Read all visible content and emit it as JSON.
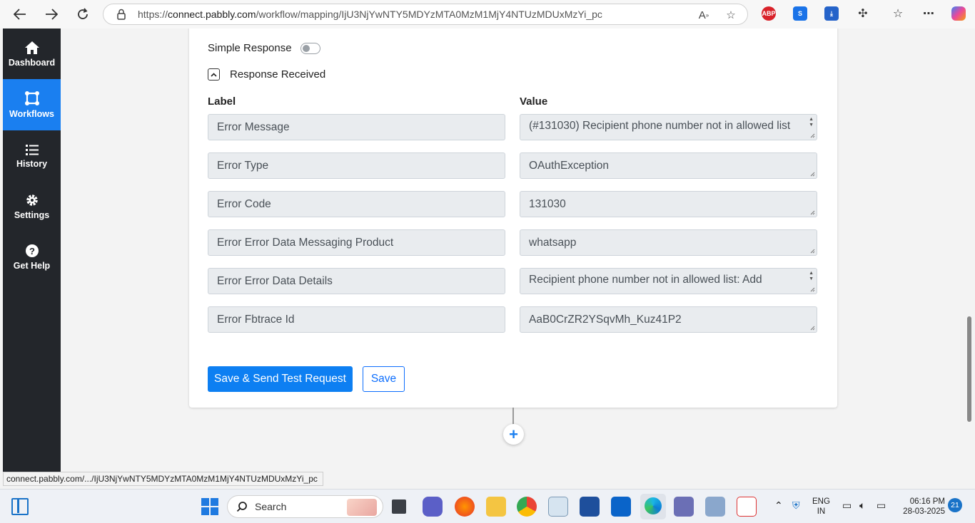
{
  "browser": {
    "url_prefix": "https://",
    "url_host": "connect.pabbly.com",
    "url_path": "/workflow/mapping/IjU3NjYwNTY5MDYzMTA0MzM1MjY4NTUzMDUxMzYi_pc",
    "extension_abp": "ABP"
  },
  "sidebar": {
    "items": [
      {
        "label": "Dashboard",
        "icon": "home-icon"
      },
      {
        "label": "Workflows",
        "icon": "workflow-icon"
      },
      {
        "label": "History",
        "icon": "list-icon"
      },
      {
        "label": "Settings",
        "icon": "gear-icon"
      },
      {
        "label": "Get Help",
        "icon": "help-icon"
      }
    ]
  },
  "response": {
    "simple_response_label": "Simple Response",
    "simple_response_on": false,
    "section_title": "Response Received",
    "label_header": "Label",
    "value_header": "Value",
    "rows": [
      {
        "label": "Error Message",
        "value": "(#131030) Recipient phone number not in allowed list"
      },
      {
        "label": "Error Type",
        "value": "OAuthException"
      },
      {
        "label": "Error Code",
        "value": "131030"
      },
      {
        "label": "Error Error Data Messaging Product",
        "value": "whatsapp"
      },
      {
        "label": "Error Error Data Details",
        "value": "Recipient phone number not in allowed list: Add"
      },
      {
        "label": "Error Fbtrace Id",
        "value": "AaB0CrZR2YSqvMh_Kuz41P2"
      }
    ],
    "save_test_label": "Save & Send Test Request",
    "save_label": "Save"
  },
  "status_bar": {
    "link": "connect.pabbly.com/.../IjU3NjYwNTY5MDYzMTA0MzM1MjY4NTUzMDUxMzYi_pc"
  },
  "taskbar": {
    "search_placeholder": "Search",
    "lang_top": "ENG",
    "lang_bottom": "IN",
    "time": "06:16 PM",
    "date": "28-03-2025",
    "notification_count": "21"
  },
  "colors": {
    "accent": "#1a7ff0",
    "sidebar_bg": "#23262b"
  }
}
